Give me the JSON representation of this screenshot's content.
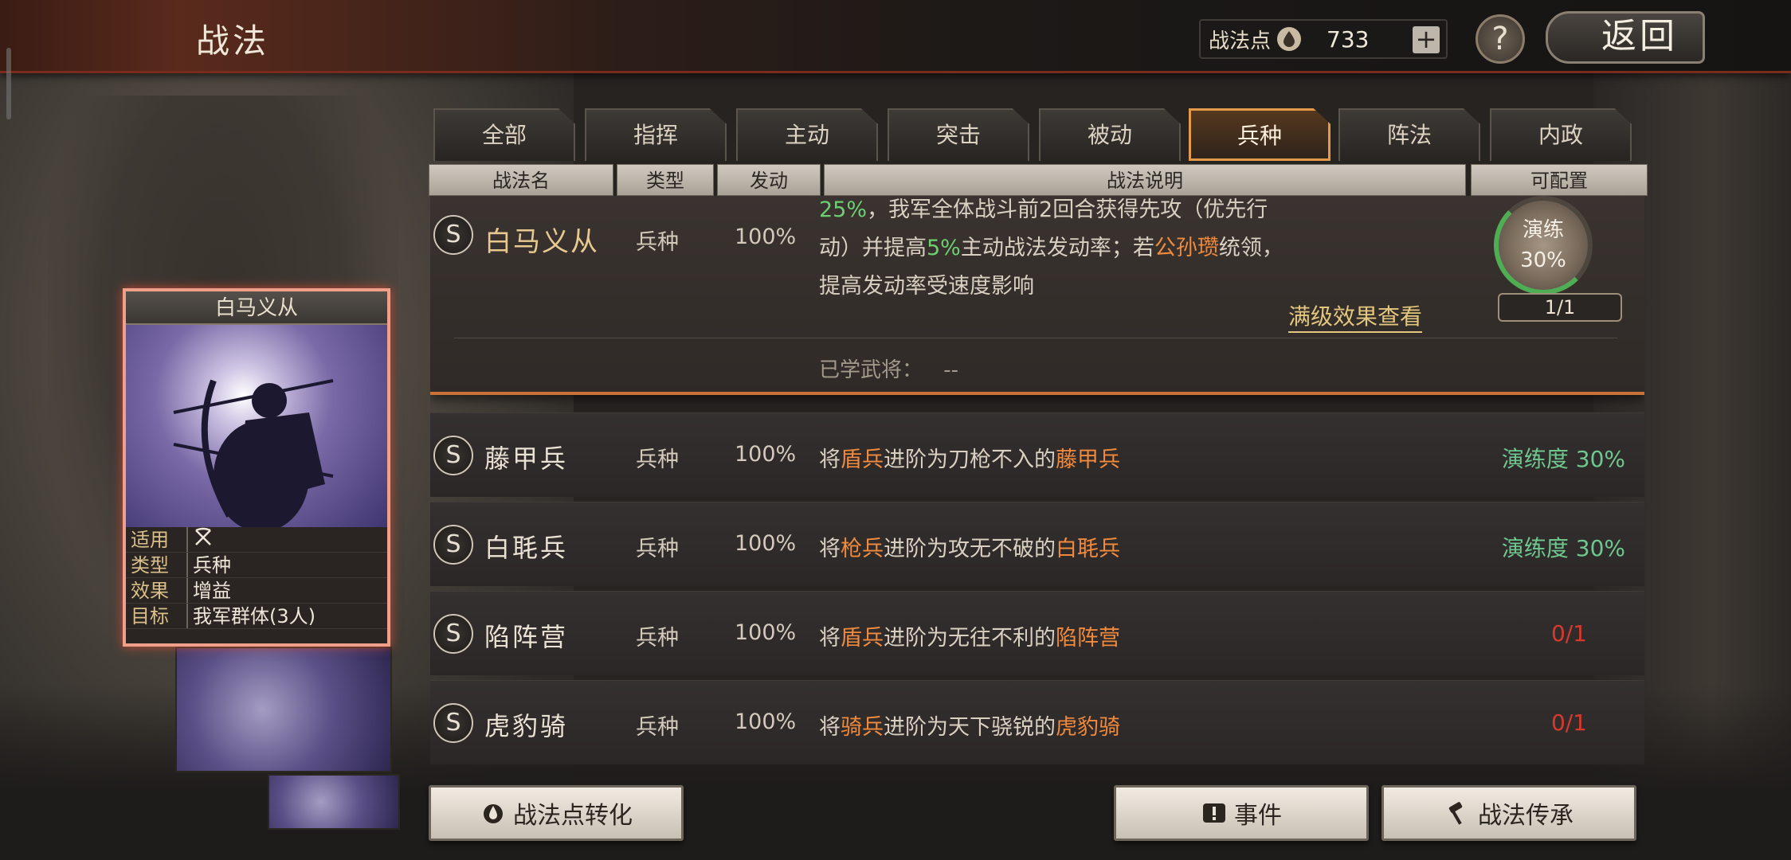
{
  "header": {
    "title": "战法",
    "points_label": "战法点",
    "points_value": "733",
    "plus": "+",
    "help": "?",
    "back": "返回"
  },
  "tabs": [
    "全部",
    "指挥",
    "主动",
    "突击",
    "被动",
    "兵种",
    "阵法",
    "内政"
  ],
  "active_tab": "兵种",
  "columns": [
    "战法名",
    "类型",
    "发动",
    "战法说明",
    "可配置"
  ],
  "expanded": {
    "badge": "S",
    "name": "白马义从",
    "type": "兵种",
    "rate": "100%",
    "desc_parts": [
      "25%",
      "，我军全体战斗前2回合获得先攻（优先行动）并提高",
      "5%",
      "主动战法发动率；若",
      "公孙瓒",
      "统领，提高发动率受速度影响"
    ],
    "full_effect_link": "满级效果查看",
    "learned_label": "已学武将：",
    "learned_value": "--",
    "drill_label": "演练",
    "drill_value": "30%",
    "capacity": "1/1"
  },
  "rows": [
    {
      "badge": "S",
      "name": "藤甲兵",
      "type": "兵种",
      "rate": "100%",
      "d1": "将",
      "d2": "盾兵",
      "d3": "进阶为刀枪不入的",
      "d4": "藤甲兵",
      "status": "演练度 30%"
    },
    {
      "badge": "S",
      "name": "白毦兵",
      "type": "兵种",
      "rate": "100%",
      "d1": "将",
      "d2": "枪兵",
      "d3": "进阶为攻无不破的",
      "d4": "白毦兵",
      "status": "演练度 30%"
    },
    {
      "badge": "S",
      "name": "陷阵营",
      "type": "兵种",
      "rate": "100%",
      "d1": "将",
      "d2": "盾兵",
      "d3": "进阶为无往不利的",
      "d4": "陷阵营",
      "status": "0/1"
    },
    {
      "badge": "S",
      "name": "虎豹骑",
      "type": "兵种",
      "rate": "100%",
      "d1": "将",
      "d2": "骑兵",
      "d3": "进阶为天下骁锐的",
      "d4": "虎豹骑",
      "status": "0/1"
    }
  ],
  "card": {
    "title": "白马义从",
    "rows": [
      {
        "k": "适用",
        "v": ""
      },
      {
        "k": "类型",
        "v": "兵种"
      },
      {
        "k": "效果",
        "v": "增益"
      },
      {
        "k": "目标",
        "v": "我军群体(3人)"
      }
    ]
  },
  "buttons": {
    "convert": "战法点转化",
    "events": "事件",
    "inherit": "战法传承"
  },
  "colors": {
    "accent_orange": "#f08a3c",
    "green": "#6ecf72",
    "red": "#d63a2c",
    "gold": "#e7c990"
  },
  "icons": [
    "drop-icon",
    "plus-icon",
    "help-icon",
    "back-icon",
    "crossed-bows-icon",
    "event-icon",
    "hammer-icon"
  ]
}
